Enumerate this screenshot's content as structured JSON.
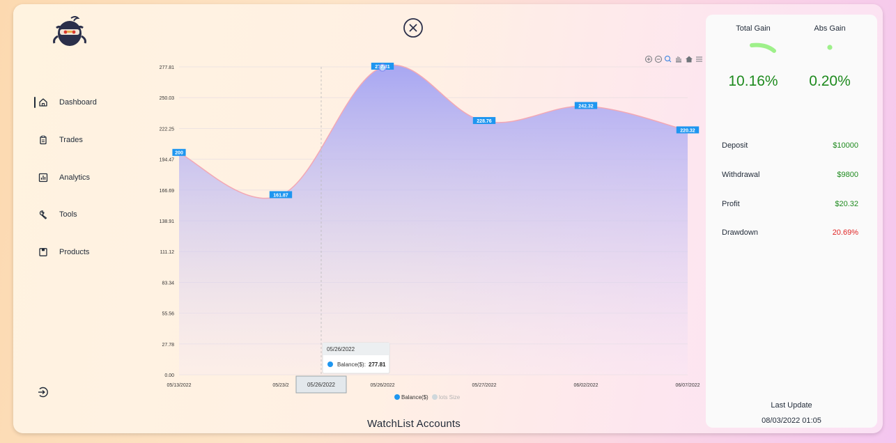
{
  "brand": {
    "logo_icon": "ninja-logo-icon"
  },
  "nav": {
    "items": [
      {
        "label": "Dashboard",
        "icon": "home-icon",
        "active": true
      },
      {
        "label": "Trades",
        "icon": "clipboard-icon",
        "active": false
      },
      {
        "label": "Analytics",
        "icon": "bar-chart-icon",
        "active": false
      },
      {
        "label": "Tools",
        "icon": "wrench-icon",
        "active": false
      },
      {
        "label": "Products",
        "icon": "box-icon",
        "active": false
      }
    ],
    "logout_icon": "logout-icon"
  },
  "main": {
    "title": "WatchList Accounts"
  },
  "chart_data": {
    "type": "area",
    "x": [
      "05/13/2022",
      "05/23/2022",
      "05/26/2022",
      "05/27/2022",
      "06/02/2022",
      "06/07/2022"
    ],
    "x_tick_labels": [
      "05/13/2022",
      "05/23/2",
      "05/26/2022",
      "05/27/2022",
      "06/02/2022",
      "06/07/2022"
    ],
    "series": [
      {
        "name": "Balance($)",
        "values": [
          200,
          161.87,
          277.81,
          228.76,
          242.32,
          220.32
        ],
        "data_labels": [
          "200",
          "161.87",
          "277.81",
          "228.76",
          "242.32",
          "220.32"
        ],
        "color": "#3b9cf0"
      },
      {
        "name": "lots Size",
        "values": [],
        "color": "#cfd8dc",
        "hidden": true
      }
    ],
    "y_ticks": [
      "0.00",
      "27.78",
      "55.56",
      "83.34",
      "111.12",
      "138.91",
      "166.69",
      "194.47",
      "222.25",
      "250.03",
      "277.81"
    ],
    "ylim": [
      0,
      277.81
    ],
    "grid": true,
    "legend": "bottom-center",
    "tooltip": {
      "date": "05/26/2022",
      "series": "Balance($):",
      "value": "277.81"
    },
    "crosshair_label": "05/26/2022",
    "toolbar_icons": [
      "zoom-in-icon",
      "zoom-out-icon",
      "magnify-icon",
      "pan-icon",
      "home-icon",
      "menu-icon"
    ],
    "colors": {
      "area_top": "#a3a3f3",
      "line": "#f3a8b4",
      "label_bg": "#1e96f0"
    }
  },
  "panel": {
    "total_gain_label": "Total Gain",
    "abs_gain_label": "Abs Gain",
    "total_gain_value": "10.16%",
    "abs_gain_value": "0.20%",
    "stats": [
      {
        "label": "Deposit",
        "value": "$10000",
        "color": "#1e8a1e"
      },
      {
        "label": "Withdrawal",
        "value": "$9800",
        "color": "#1e8a1e"
      },
      {
        "label": "Profit",
        "value": "$20.32",
        "color": "#1e8a1e"
      },
      {
        "label": "Drawdown",
        "value": "20.69%",
        "color": "#e02424"
      }
    ],
    "last_update_label": "Last Update",
    "last_update_value": "08/03/2022 01:05"
  }
}
